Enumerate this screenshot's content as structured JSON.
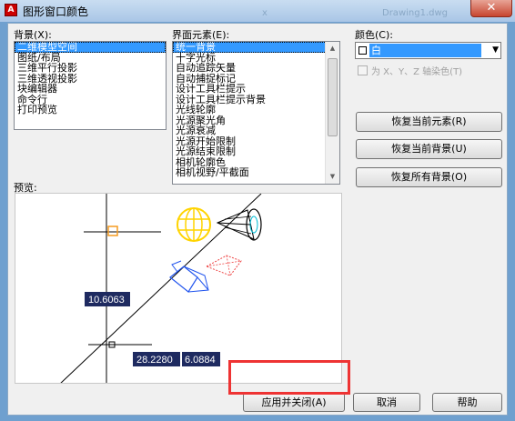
{
  "window": {
    "title": "图形窗口颜色",
    "close_glyph": "✕",
    "app_icon_glyph": "A",
    "faded_title_a": "x",
    "faded_title_b": "Drawing1.dwg"
  },
  "background": {
    "label": "背景(X):",
    "items": [
      "二维模型空间",
      "图纸/布局",
      "三维平行投影",
      "三维透视投影",
      "块编辑器",
      "命令行",
      "打印预览"
    ],
    "selected_index": 0
  },
  "interface_elements": {
    "label": "界面元素(E):",
    "items": [
      "统一背景",
      "十字光标",
      "自动追踪矢量",
      "自动捕捉标记",
      "设计工具栏提示",
      "设计工具栏提示背景",
      "光线轮廓",
      "光源聚光角",
      "光源衰减",
      "光源开始限制",
      "光源结束限制",
      "相机轮廓色",
      "相机视野/平截面"
    ],
    "selected_index": 0,
    "scroll_up": "▲",
    "scroll_down": "▼"
  },
  "color": {
    "label": "颜色(C):",
    "value": "白",
    "arrow": "▼",
    "tint_checkbox_label": "为 X、Y、Z 轴染色(T)",
    "tint_checked": false
  },
  "restore": {
    "element_button": "恢复当前元素(R)",
    "context_button": "恢复当前背景(U)",
    "all_button": "恢复所有背景(O)"
  },
  "preview": {
    "label": "预览:",
    "dim_left": "10.6063",
    "dim_bottom_1": "28.2280",
    "dim_bottom_2": "6.0884"
  },
  "footer": {
    "apply_close": "应用并关闭(A)",
    "cancel": "取消",
    "help": "帮助"
  },
  "colors": {
    "selection": "#3399ff",
    "dim_box": "#1e2a60",
    "light_bulb": "#ffd400",
    "highlight_frame": "#ee3333"
  }
}
